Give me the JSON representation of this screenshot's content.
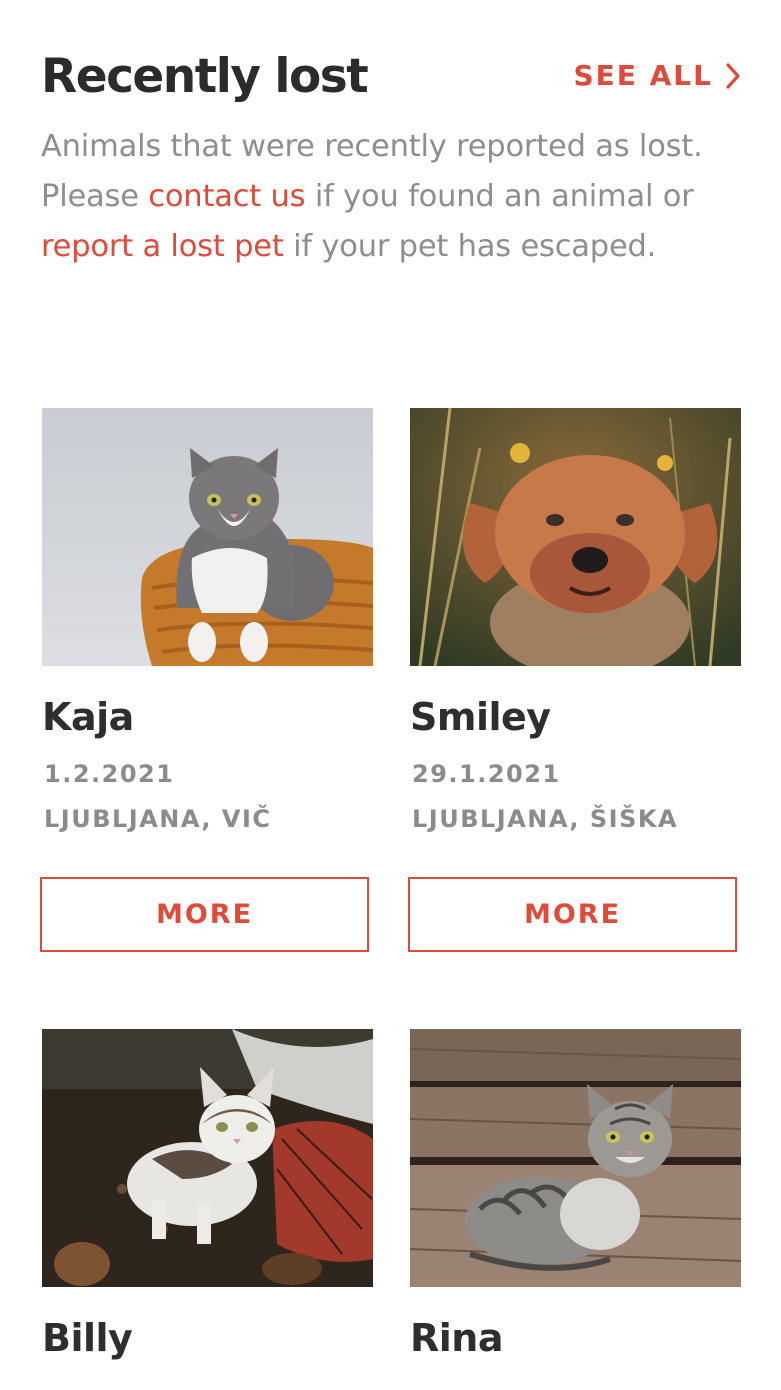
{
  "section": {
    "title": "Recently lost",
    "see_all_label": "SEE ALL",
    "description": {
      "part1": "Animals that were recently reported as lost. Please ",
      "contact_link": "contact us",
      "part2": " if you found an animal or ",
      "report_link": "report a lost pet",
      "part3": " if your pet has escaped."
    }
  },
  "accent_color": "#e04a3a",
  "pets": [
    {
      "name": "Kaja",
      "date": "1.2.2021",
      "location": "LJUBLJANA, VIČ",
      "more_label": "MORE",
      "photo_icon": "gray-white-cat-in-basket"
    },
    {
      "name": "Smiley",
      "date": "29.1.2021",
      "location": "LJUBLJANA, ŠIŠKA",
      "more_label": "MORE",
      "photo_icon": "yorkshire-terrier-dog"
    },
    {
      "name": "Billy",
      "date": "",
      "location": "",
      "more_label": "",
      "photo_icon": "white-tabby-kitten"
    },
    {
      "name": "Rina",
      "date": "",
      "location": "",
      "more_label": "",
      "photo_icon": "gray-tabby-cat-on-wood"
    }
  ]
}
